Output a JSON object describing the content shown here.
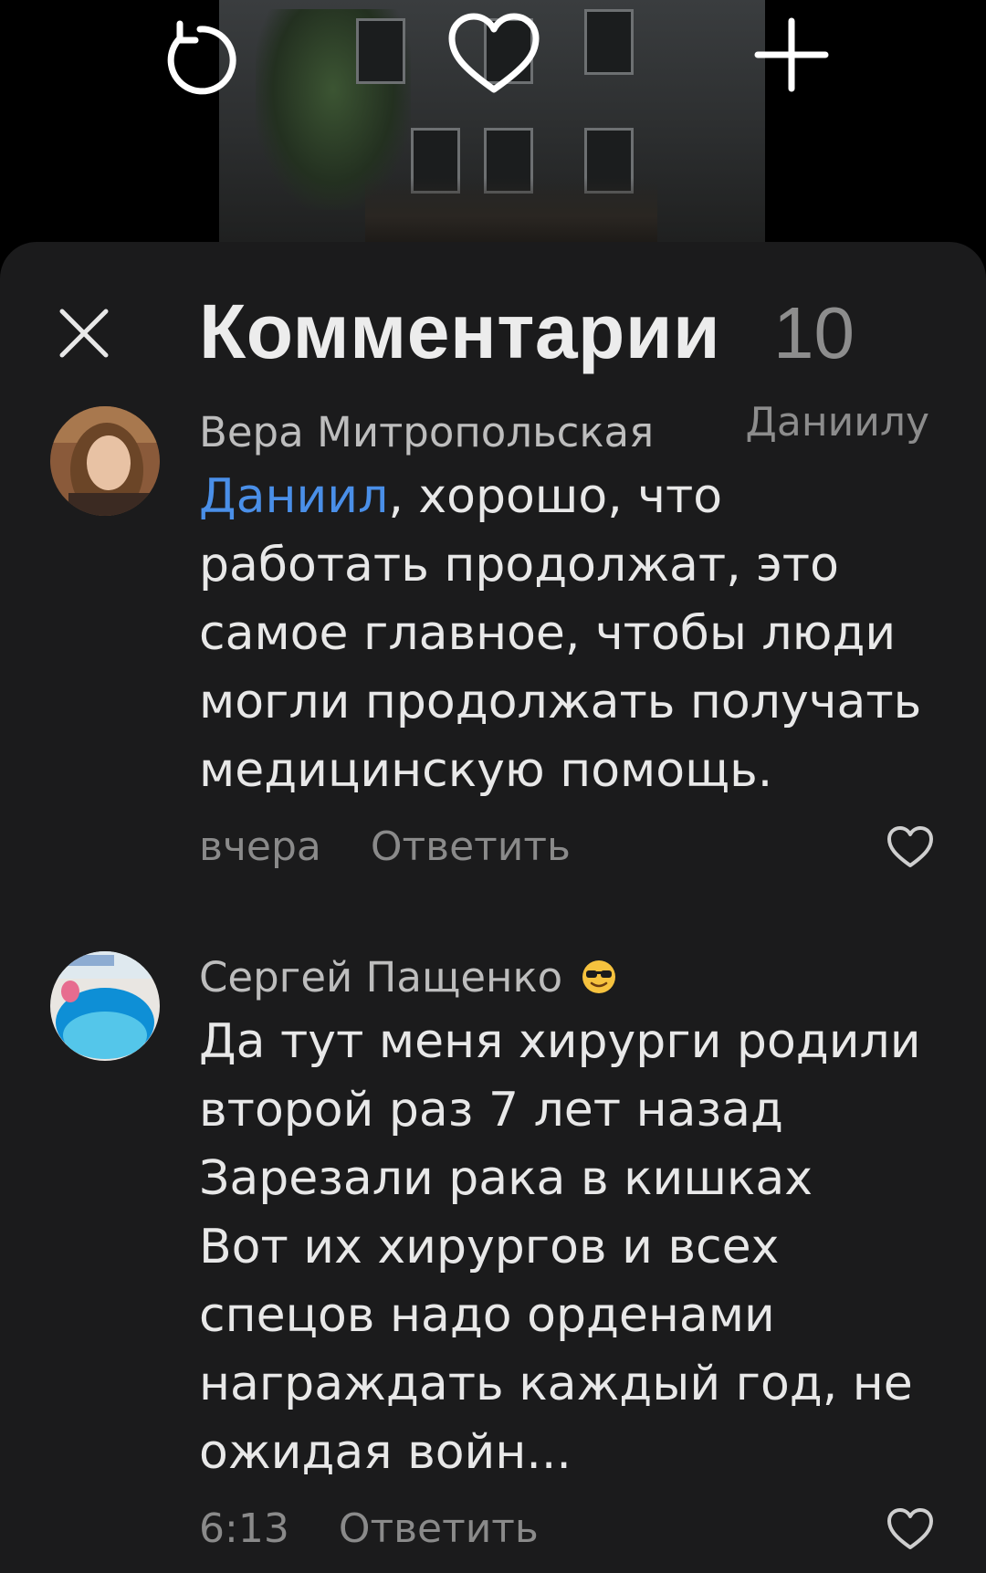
{
  "top_actions": {
    "replay_icon": "replay-icon",
    "like_icon": "heart-icon",
    "add_icon": "plus-icon"
  },
  "comments_panel": {
    "title": "Комментарии",
    "count": "10",
    "close_icon": "close-icon"
  },
  "comments": [
    {
      "author": "Вера Митропольская",
      "reply_to": "Даниилу",
      "mention": "Даниил",
      "lines": [
        ", хорошо, что",
        "работать продолжат, это",
        "самое главное, чтобы люди",
        "могли продолжать получать",
        "медицинскую помощь."
      ],
      "time": "вчера",
      "reply_label": "Ответить",
      "like_icon": "heart-outline-icon"
    },
    {
      "author": "Сергей Пащенко",
      "author_emoji": "😎",
      "lines": [
        "Да тут меня хирурги родили",
        "второй раз 7 лет назад",
        "Зарезали рака в кишках",
        "Вот их хирургов и всех",
        "спецов надо орденами",
        "награждать каждый год, не",
        "ожидая войн..."
      ],
      "time": "6:13",
      "reply_label": "Ответить",
      "like_icon": "heart-outline-icon"
    }
  ],
  "colors": {
    "sheet_bg": "#1b1b1c",
    "mention": "#4a8fe8",
    "secondary_text": "#8a8a8a"
  }
}
